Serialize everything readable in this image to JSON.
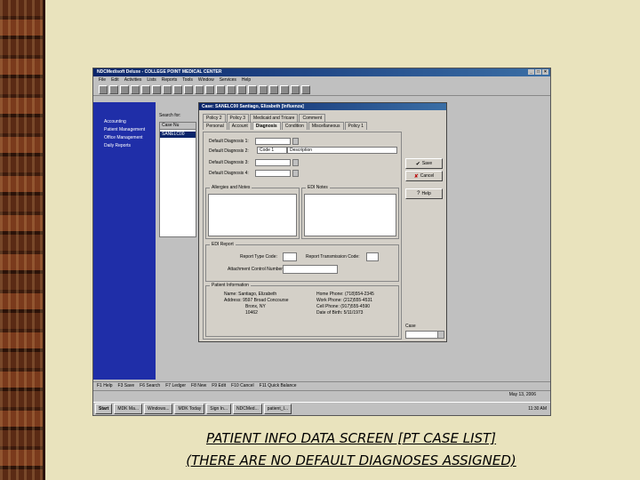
{
  "window": {
    "title": "NDCMedisoft Deluxe - COLLEGE POINT MEDICAL CENTER",
    "menus": [
      "File",
      "Edit",
      "Activities",
      "Lists",
      "Reports",
      "Tools",
      "Window",
      "Services",
      "Help"
    ]
  },
  "left_nav": {
    "items": [
      "Accounting",
      "Patient Management",
      "Office Management",
      "Daily Reports"
    ]
  },
  "case_list": {
    "search_label": "Search for:",
    "header": "Case  Nu",
    "selected_row": "SANELC00"
  },
  "dialog": {
    "title": "Case: SANELC00 Santiago, Elizabeth [Influenza]",
    "tabs_row1": [
      "Policy 2",
      "Policy 3",
      "Medicaid and Tricare",
      "Comment"
    ],
    "tabs_row2": [
      "Personal",
      "Account",
      "Diagnosis",
      "Condition",
      "Miscellaneous",
      "Policy 1"
    ],
    "active_tab": "Diagnosis",
    "diagnosis_fields": [
      {
        "label": "Default Diagnosis 1:",
        "value": ""
      },
      {
        "label": "Default Diagnosis 2:",
        "value": ""
      },
      {
        "label": "Default Diagnosis 3:",
        "value": ""
      },
      {
        "label": "Default Diagnosis 4:",
        "value": ""
      }
    ],
    "code_header": "Code 1",
    "description_header": "Description",
    "allergies_label": "Allergies and Notes",
    "edi_notes_label": "EDI Notes",
    "edi_report": {
      "group_label": "EDI Report",
      "report_type_code": "Report Type Code:",
      "report_transmission_code": "Report Transmission Code:",
      "attachment_control_number": "Attachment Control Number:"
    },
    "patient_info": {
      "group_label": "Patient Information",
      "name": "Name: Santiago, Elizabeth",
      "address_line1": "Address: 9597 Broad Concourse",
      "address_line2": "Bronx, NY",
      "address_line3": "10462",
      "home_phone": "Home Phone: (718)554-2345",
      "work_phone": "Work Phone: (212)555-4531",
      "cell_phone": "Cell Phone: (917)555-4590",
      "dob": "Date of Birth: 5/11/1973"
    },
    "buttons": {
      "save": "Save",
      "cancel": "Cancel",
      "help": "Help"
    },
    "case_label": "Case"
  },
  "function_bar": [
    "F1 Help",
    "F3 Save",
    "F6 Search",
    "F7 Ledger",
    "F8 New",
    "F9 Edit",
    "F10 Cancel",
    "F11 Quick Balance"
  ],
  "status_bar": {
    "date": "May 13, 2006"
  },
  "taskbar": {
    "start": "Start",
    "tasks": [
      "MDK Ma...",
      "Windows...",
      "MDK Today",
      "Sign In...",
      "NDCMed...",
      "patient_I..."
    ],
    "clock": "11:30 AM"
  },
  "caption": {
    "line1": "PATIENT INFO DATA SCREEN  [PT CASE LIST]",
    "line2": "(THERE ARE NO DEFAULT DIAGNOSES ASSIGNED)"
  }
}
